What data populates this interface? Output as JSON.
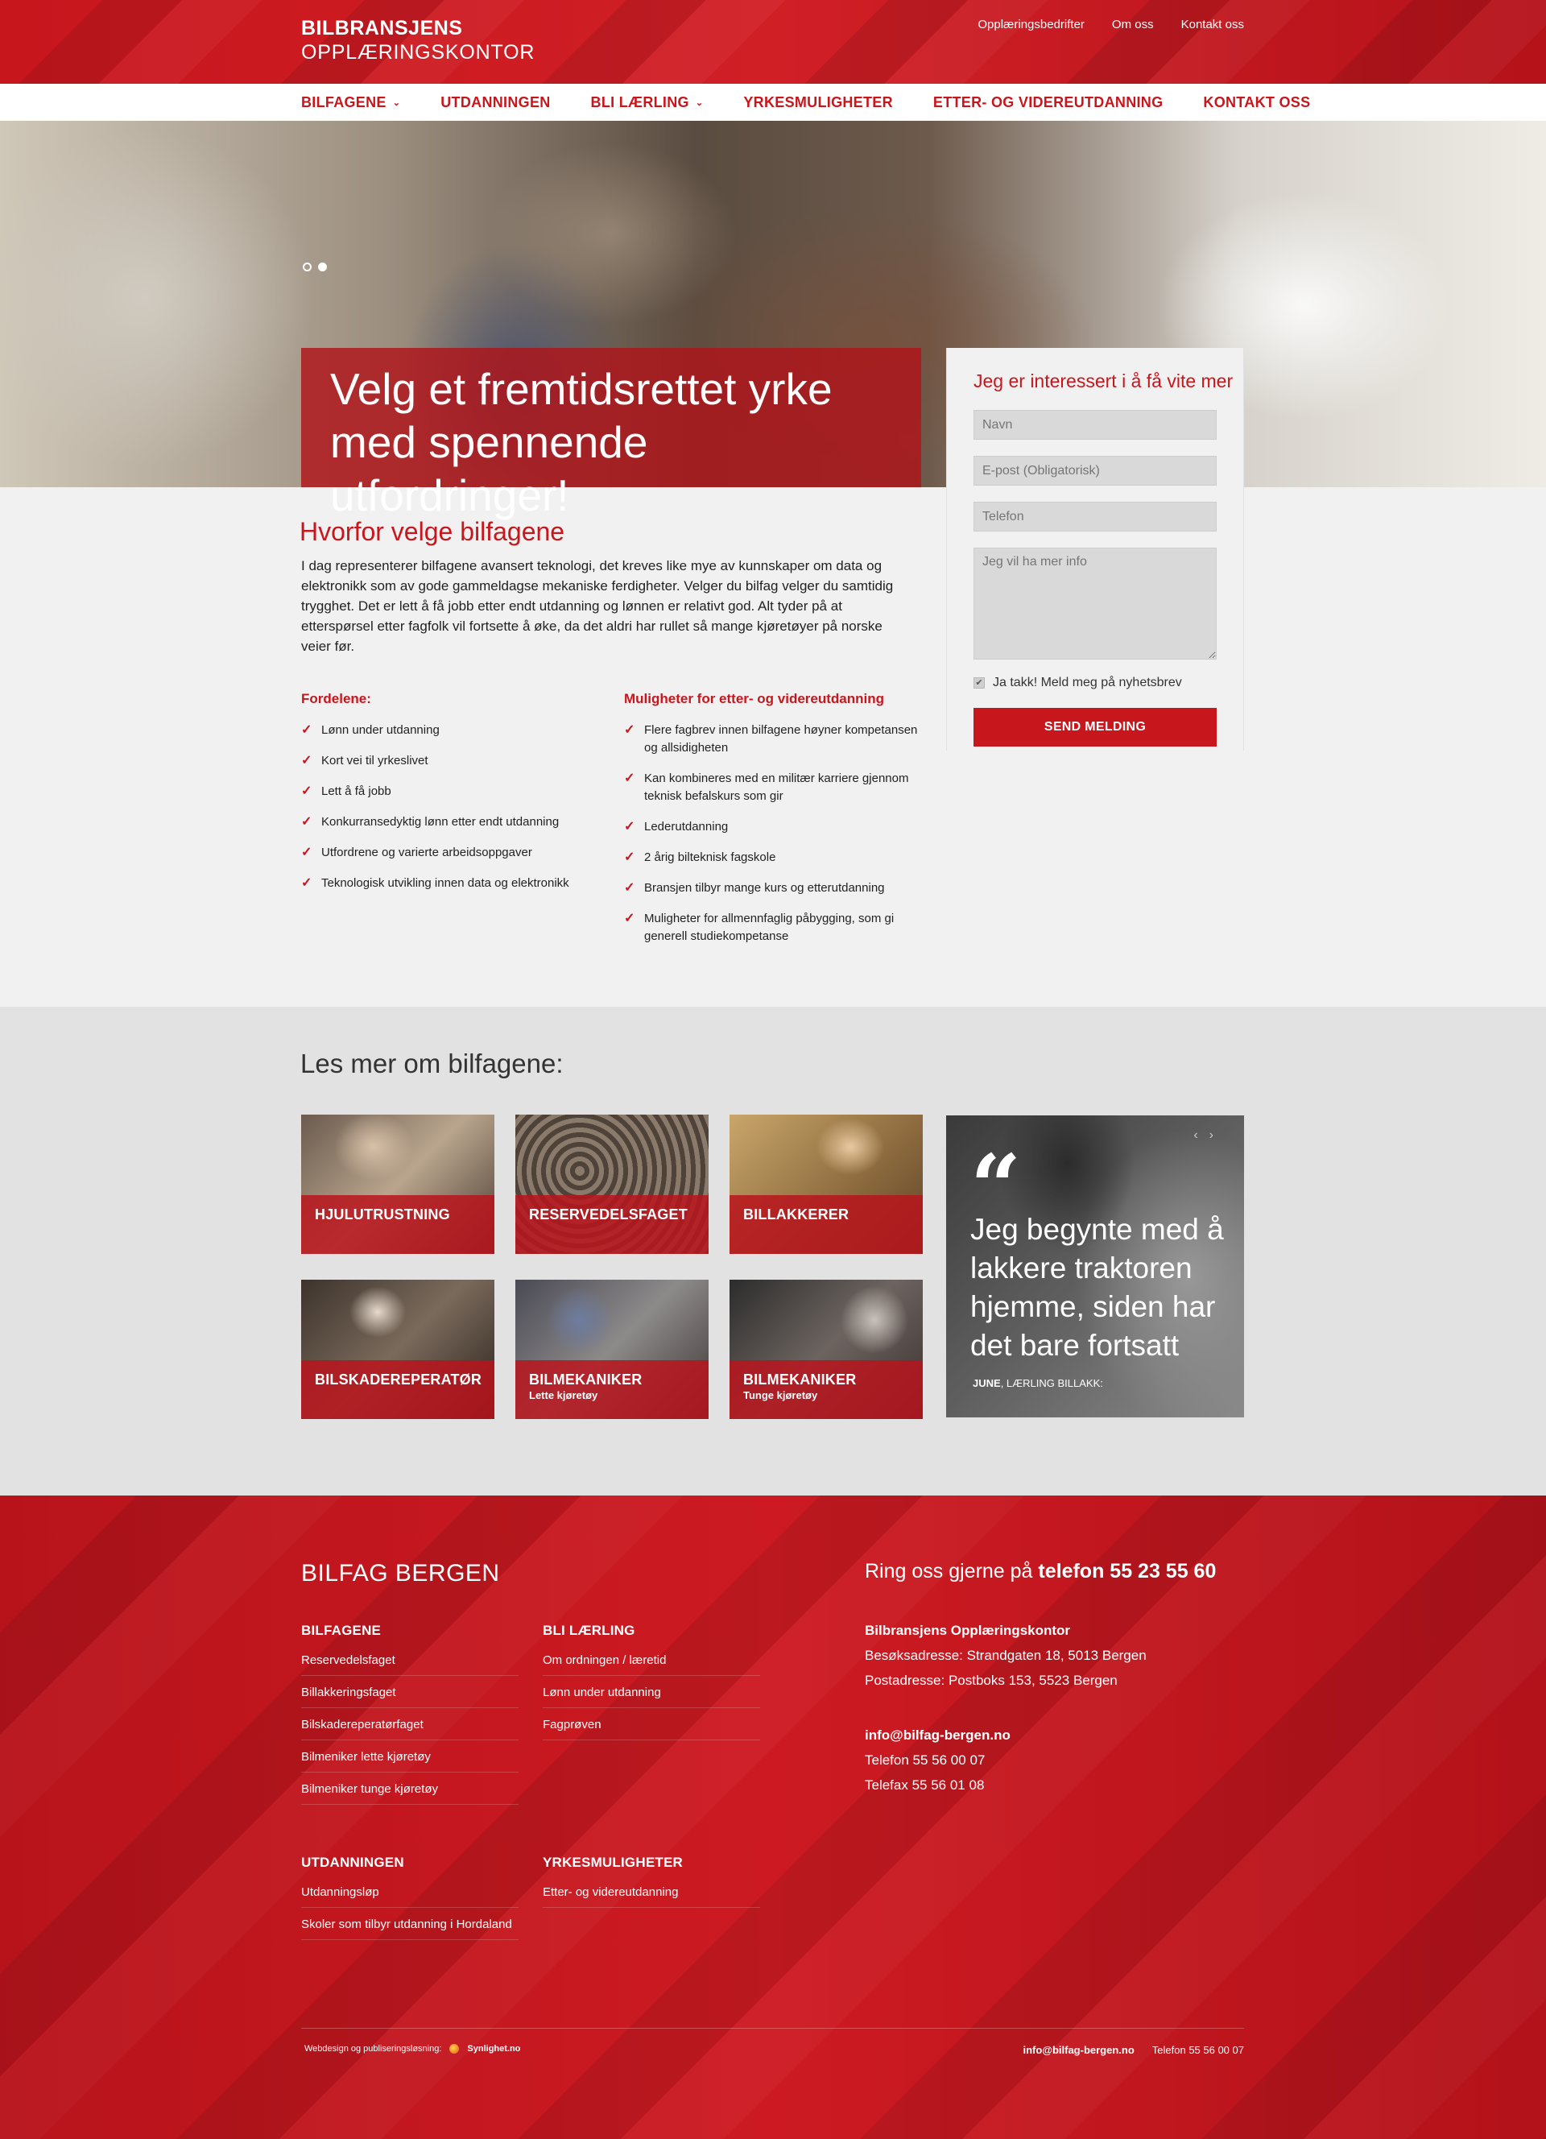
{
  "logo": {
    "line1": "BILBRANSJENS",
    "line2": "OPPLÆRINGSKONTOR"
  },
  "top_links": [
    "Opplæringsbedrifter",
    "Om oss",
    "Kontakt oss"
  ],
  "main_nav": [
    {
      "label": "BILFAGENE",
      "has_dropdown": true
    },
    {
      "label": "UTDANNINGEN",
      "has_dropdown": false
    },
    {
      "label": "BLI LÆRLING",
      "has_dropdown": true
    },
    {
      "label": "YRKESMULIGHETER",
      "has_dropdown": false
    },
    {
      "label": "ETTER- OG VIDEREUTDANNING",
      "has_dropdown": false
    },
    {
      "label": "KONTAKT OSS",
      "has_dropdown": false
    }
  ],
  "hero": {
    "headline_line1": "Velg et fremtidsrettet yrke",
    "headline_line2": "med spennende utfordringer!",
    "slides_total": 2,
    "active_slide": 2
  },
  "form": {
    "title": "Jeg er interessert i å få vite mer",
    "name_placeholder": "Navn",
    "email_placeholder": "E-post (Obligatorisk)",
    "phone_placeholder": "Telefon",
    "message_placeholder": "Jeg vil ha mer info",
    "newsletter_label": "Ja takk! Meld meg på nyhetsbrev",
    "newsletter_checked": true,
    "submit_label": "SEND MELDING"
  },
  "why": {
    "title": "Hvorfor velge bilfagene",
    "text": "I dag representerer bilfagene avansert teknologi, det kreves like mye av kunnskaper om data og elektronikk som av gode gammeldagse mekaniske ferdigheter. Velger du bilfag velger du samtidig trygghet. Det er lett å få jobb etter endt utdanning og lønnen er relativt god. Alt tyder på at etterspørsel etter fagfolk vil fortsette å øke, da det aldri har rullet så mange kjøretøyer på norske veier før."
  },
  "advantages": {
    "title": "Fordelene:",
    "items": [
      "Lønn under utdanning",
      "Kort vei til yrkeslivet",
      "Lett å få jobb",
      "Konkurransedyktig lønn etter endt utdanning",
      "Utfordrene og varierte arbeidsoppgaver",
      "Teknologisk utvikling innen data og elektronikk"
    ]
  },
  "further_education": {
    "title": "Muligheter for etter- og videreutdanning",
    "items": [
      "Flere fagbrev innen bilfagene høyner kompetansen og allsidigheten",
      "Kan kombineres med en militær karriere gjennom teknisk befalskurs som gir",
      "Lederutdanning",
      "2 årig bilteknisk fagskole",
      "Bransjen tilbyr mange kurs og etterutdanning",
      "Muligheter for allmennfaglig påbygging, som gi generell studiekompetanse"
    ]
  },
  "read_more": {
    "title": "Les mer om bilfagene:",
    "tiles": [
      {
        "title": "HJULUTRUSTNING",
        "subtitle": ""
      },
      {
        "title": "RESERVEDELSFAGET",
        "subtitle": ""
      },
      {
        "title": "BILLAKKERER",
        "subtitle": ""
      },
      {
        "title": "BILSKADEREPERATØR",
        "subtitle": ""
      },
      {
        "title": "BILMEKANIKER",
        "subtitle": "Lette kjøretøy"
      },
      {
        "title": "BILMEKANIKER",
        "subtitle": "Tunge kjøretøy"
      }
    ],
    "quote": {
      "text": "Jeg begynte med å lakkere traktoren hjemme, siden har det bare fortsatt",
      "author": "JUNE",
      "role": ", LÆRLING BILLAKK:"
    }
  },
  "footer": {
    "brand": "BILFAG BERGEN",
    "columns": [
      {
        "title": "BILFAGENE",
        "links": [
          "Reservedelsfaget",
          "Billakkeringsfaget",
          "Bilskadereperatørfaget",
          "Bilmeniker lette kjøretøy",
          "Bilmeniker tunge kjøretøy"
        ]
      },
      {
        "title": "BLI LÆRLING",
        "links": [
          "Om ordningen / læretid",
          "Lønn under utdanning",
          "Fagprøven"
        ]
      },
      {
        "title": "UTDANNINGEN",
        "links": [
          "Utdanningsløp",
          "Skoler som tilbyr utdanning i Hordaland"
        ]
      },
      {
        "title": "YRKESMULIGHETER",
        "links": [
          "Etter- og videreutdanning"
        ]
      }
    ],
    "call_prefix": "Ring oss gjerne på ",
    "call_phone": "telefon 55 23 55 60",
    "org_name": "Bilbransjens Opplæringskontor",
    "visit_address": "Besøksadresse: Strandgaten 18, 5013 Bergen",
    "post_address": "Postadresse: Postboks 153, 5523 Bergen",
    "email": "info@bilfag-bergen.no",
    "phone": "Telefon 55 56 00 07",
    "fax": "Telefax 55 56 01 08",
    "credit_label": "Webdesign og publiseringsløsning:",
    "credit_company": "Synlighet.no",
    "bottom_email": "info@bilfag-bergen.no",
    "bottom_phone": "Telefon 55 56 00 07"
  },
  "colors": {
    "brand_red": "#c8161d",
    "footer_red": "#c0161e",
    "section_gray": "#e3e2e3",
    "page_bg": "#f1f1f1"
  }
}
